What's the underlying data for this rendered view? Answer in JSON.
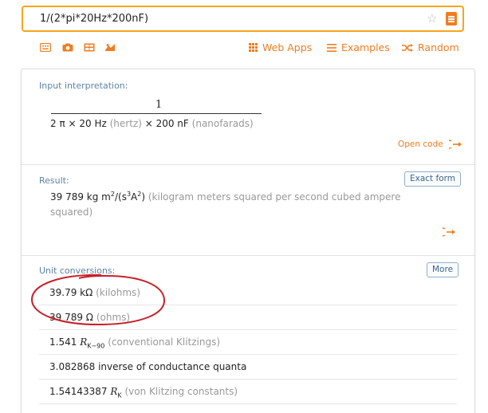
{
  "search": {
    "query": "1/(2*pi*20Hz*200nF)"
  },
  "toolbar": {
    "web_apps": "Web Apps",
    "examples": "Examples",
    "random": "Random"
  },
  "input_pod": {
    "title": "Input interpretation:",
    "numerator": "1",
    "den_main": "2 π × 20 Hz",
    "den_unit1": "(hertz)",
    "den_times": "× 200 nF",
    "den_unit2": "(nanofarads)",
    "open_code": "Open code"
  },
  "result_pod": {
    "title": "Result:",
    "exact_form": "Exact form",
    "value": "39 789 kg m",
    "value_mid": "/(s",
    "value_a": "A",
    "value_close": ")",
    "sup2a": "2",
    "sup3": "3",
    "sup2b": "2",
    "description": "(kilogram meters squared per second cubed ampere squared)"
  },
  "conversions_pod": {
    "title": "Unit conversions:",
    "more": "More",
    "rows": [
      {
        "value": "39.79 kΩ",
        "desc": "(kilohms)"
      },
      {
        "value": "39 789 Ω",
        "desc": "(ohms)"
      },
      {
        "value": "1.541",
        "sym": "R",
        "sub": "K−90",
        "desc": "(conventional Klitzings)"
      },
      {
        "value": "3.082868 inverse of conductance quanta",
        "desc": ""
      },
      {
        "value": "1.54143387",
        "sym": "R",
        "sub": "K",
        "desc": "(von Klitzing constants)"
      }
    ]
  },
  "colors": {
    "accent": "#f07d22",
    "search_border": "#f7a51c",
    "pod_title": "#5d83a5",
    "annotation": "#c8202a"
  }
}
